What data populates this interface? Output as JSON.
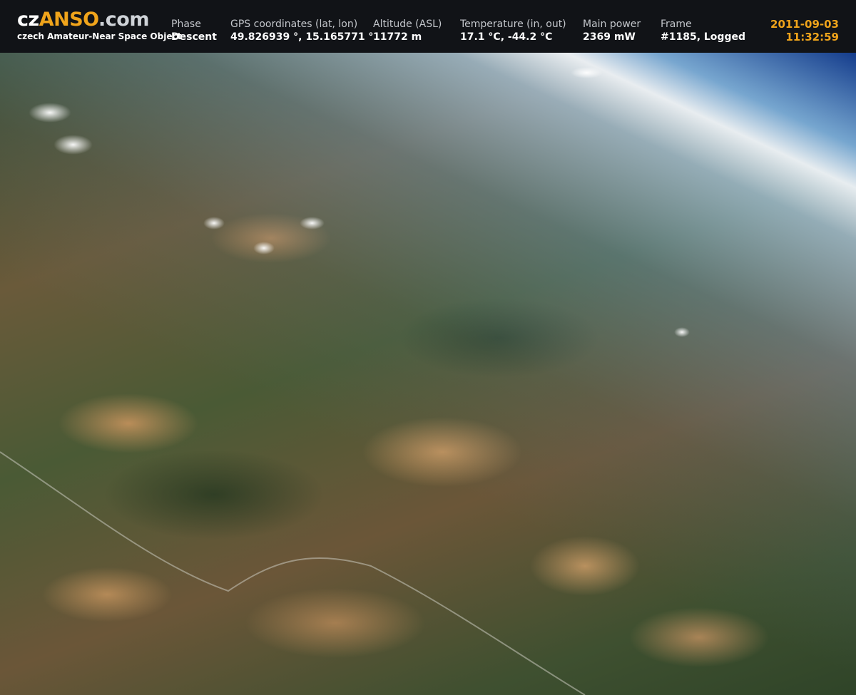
{
  "logo": {
    "prefix": "cz",
    "brand": "ANSO",
    "suffix": ".com",
    "tagline": "czech Amateur-Near Space Object"
  },
  "telemetry": {
    "phase": {
      "label": "Phase",
      "value": "Descent"
    },
    "gps": {
      "label": "GPS coordinates (lat, lon)",
      "value": "49.826939 °, 15.165771 °"
    },
    "altitude": {
      "label": "Altitude (ASL)",
      "value": "11772 m"
    },
    "temperature": {
      "label": "Temperature (in, out)",
      "value": "17.1 °C, -44.2 °C"
    },
    "power": {
      "label": "Main power",
      "value": "2369 mW"
    },
    "frame": {
      "label": "Frame",
      "value": "#1185, Logged"
    }
  },
  "timestamp": {
    "date": "2011-09-03",
    "time": "11:32:59"
  },
  "colors": {
    "header_bg": "#111317",
    "accent": "#f0a41b",
    "label_text": "#c3c6cb",
    "value_text": "#ffffff"
  }
}
